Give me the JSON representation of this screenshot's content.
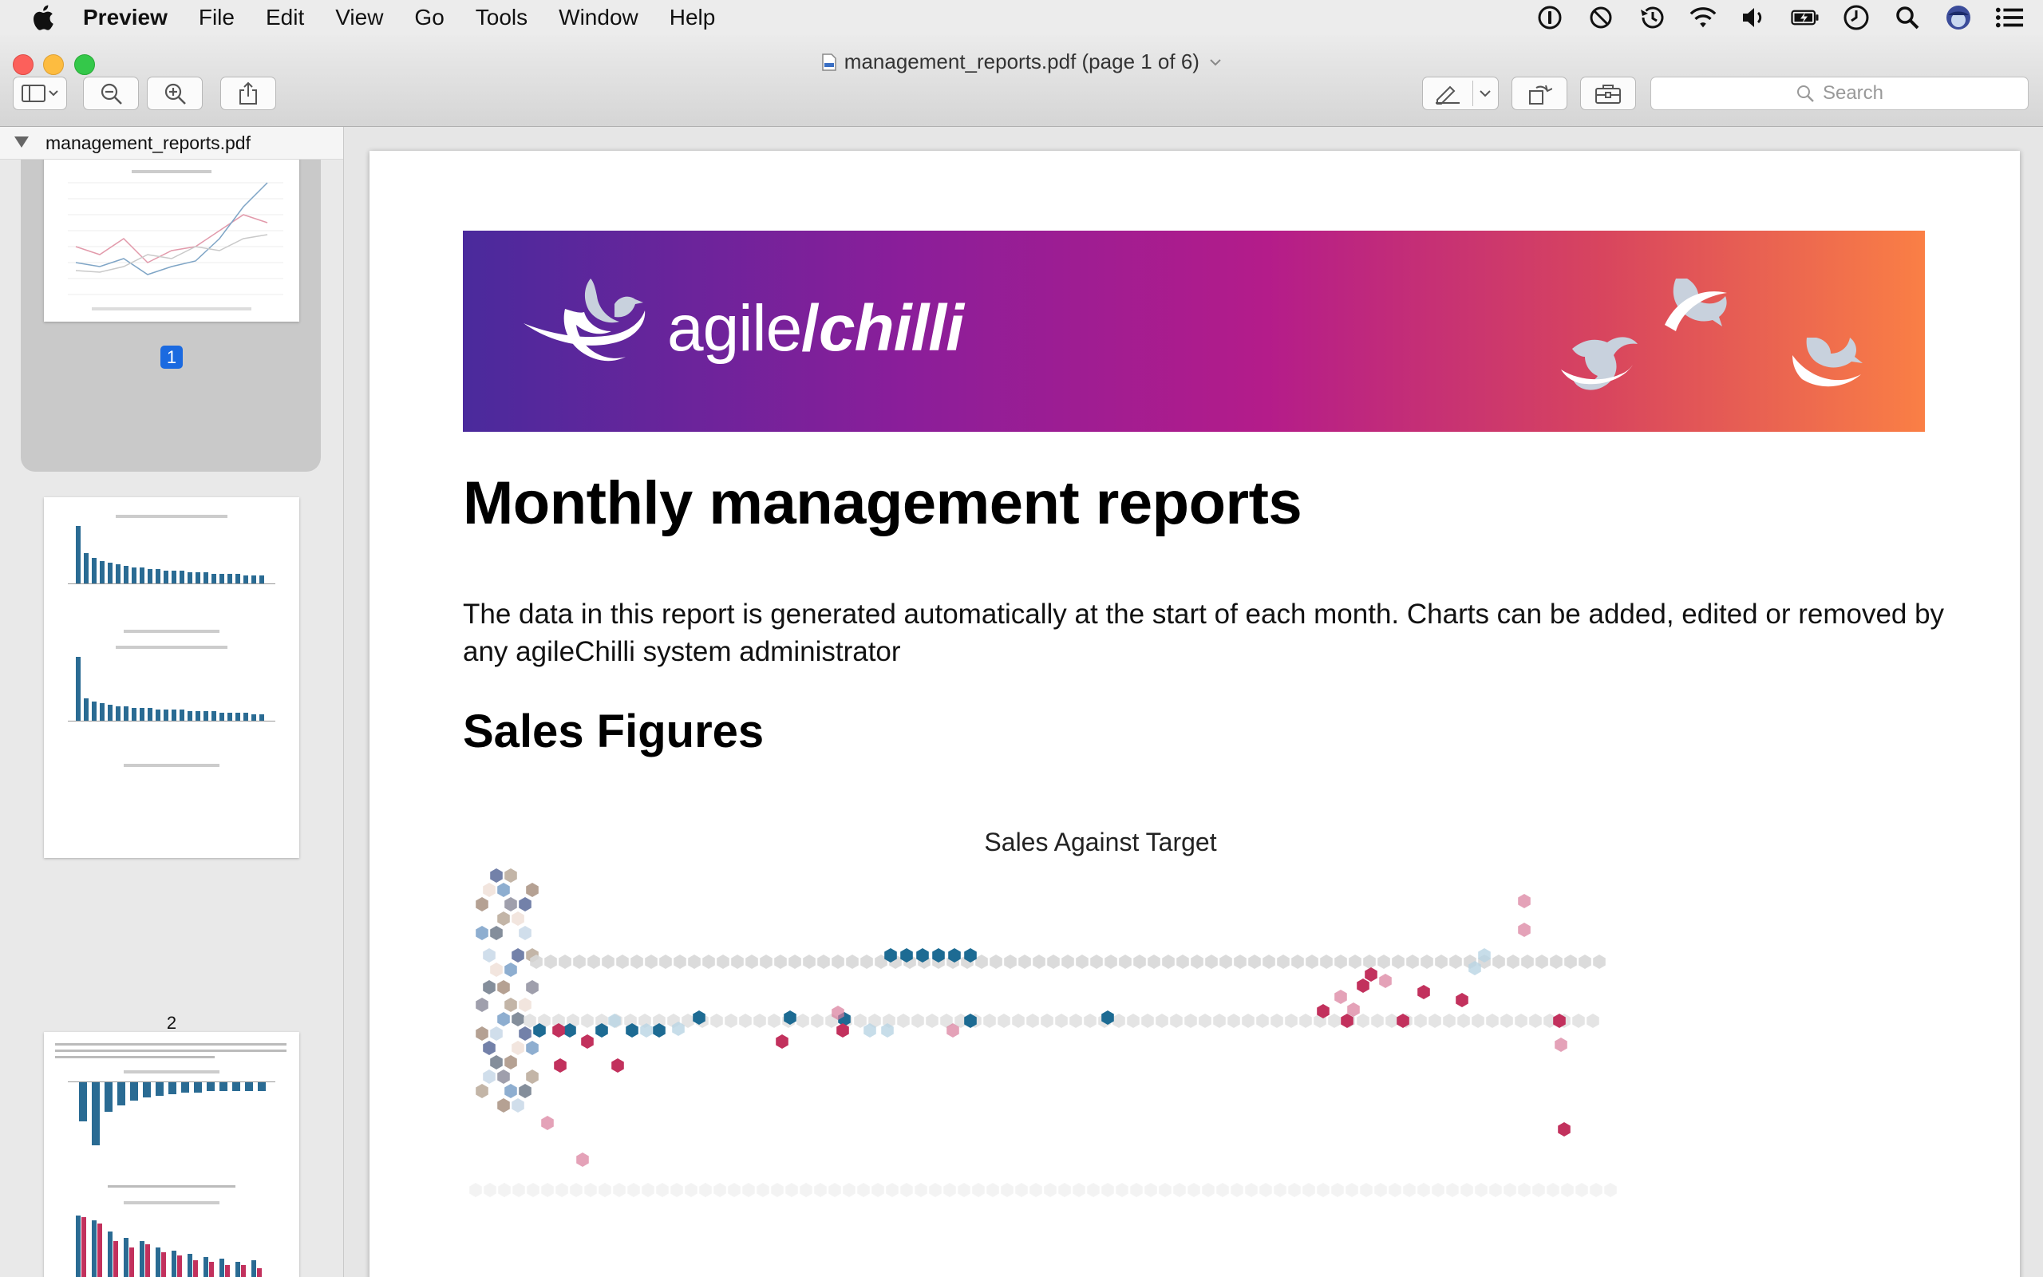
{
  "menubar": {
    "app_name": "Preview",
    "items": [
      "File",
      "Edit",
      "View",
      "Go",
      "Tools",
      "Window",
      "Help"
    ]
  },
  "window": {
    "title": "management_reports.pdf (page 1 of 6)"
  },
  "toolbar": {
    "search_placeholder": "Search"
  },
  "sidebar": {
    "file_name": "management_reports.pdf",
    "pages": [
      {
        "number": "1",
        "selected": true
      },
      {
        "number": "2",
        "selected": false
      }
    ]
  },
  "document": {
    "banner_logo_text_a": "agile",
    "banner_logo_text_b": "chilli",
    "heading": "Monthly management reports",
    "intro": "The data in this report is generated automatically at the start of each month. Charts can be added, edited or removed by any agileChilli system administrator",
    "section_heading": "Sales Figures",
    "chart_title": "Sales Against Target"
  },
  "colors": {
    "accent_blue": "#1b6ae0",
    "series_blue": "#1d6b93",
    "series_red": "#c2315d",
    "series_pink": "#d87a9a",
    "series_grey": "#d7d7d7"
  }
}
